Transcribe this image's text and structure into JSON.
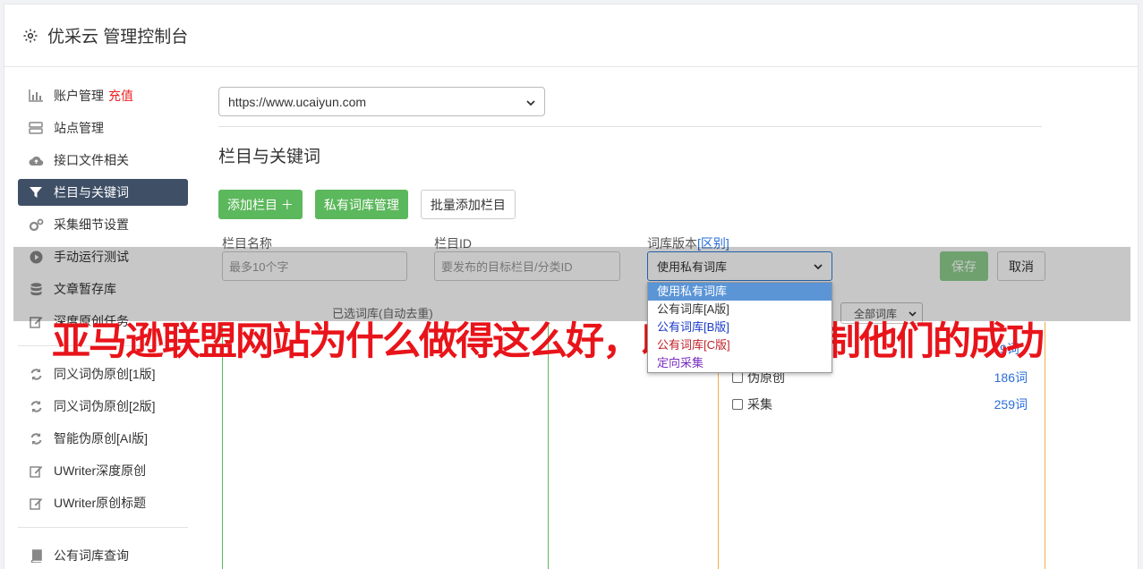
{
  "header": {
    "title": "优采云 管理控制台",
    "icon": "gear-icon"
  },
  "sidebar": {
    "items": [
      {
        "label": "账户管理",
        "badge": "充值",
        "icon": "bar-chart-icon"
      },
      {
        "label": "站点管理",
        "icon": "server-icon"
      },
      {
        "label": "接口文件相关",
        "icon": "cloud-upload-icon"
      },
      {
        "label": "栏目与关键词",
        "icon": "filter-icon",
        "active": true
      },
      {
        "label": "采集细节设置",
        "icon": "cogs-icon"
      },
      {
        "label": "手动运行测试",
        "icon": "play-circle-icon"
      },
      {
        "label": "文章暂存库",
        "icon": "database-icon"
      },
      {
        "label": "深度原创任务",
        "icon": "edit-icon"
      }
    ],
    "items2": [
      {
        "label": "同义词伪原创[1版]",
        "icon": "refresh-icon"
      },
      {
        "label": "同义词伪原创[2版]",
        "icon": "refresh-icon"
      },
      {
        "label": "智能伪原创[AI版]",
        "icon": "refresh-icon"
      },
      {
        "label": "UWriter深度原创",
        "icon": "edit-icon"
      },
      {
        "label": "UWriter原创标题",
        "icon": "edit-icon"
      }
    ],
    "items3": [
      {
        "label": "公有词库查询",
        "icon": "book-icon"
      }
    ]
  },
  "main": {
    "site_select": "https://www.ucaiyun.com",
    "section_title": "栏目与关键词",
    "buttons": {
      "add": "添加栏目 ＋",
      "private": "私有词库管理",
      "batch": "批量添加栏目"
    },
    "labels": {
      "name": "栏目名称",
      "id": "栏目ID",
      "version": "词库版本",
      "diff": "[区别]"
    },
    "placeholders": {
      "name": "最多10个字",
      "id": "要发布的目标栏目/分类ID"
    },
    "version_select": "使用私有词库",
    "save": "保存",
    "cancel": "取消",
    "selected_label": "已选词库(自动去重)",
    "all_libs": "全部词库",
    "dropdown_options": [
      "使用私有词库",
      "公有词库[A版]",
      "公有词库[B版]",
      "公有词库[C版]",
      "定向采集"
    ],
    "libs": [
      {
        "name": "伪原创",
        "count": "186词"
      },
      {
        "name": "采集",
        "count": "259词"
      }
    ],
    "partial_count": "9词"
  },
  "watermark": "亚马逊联盟网站为什么做得这么好，以及如何复制他们的成功",
  "colors": {
    "accent": "#5cb85c",
    "active_nav": "#3e4f66",
    "link": "#2a6ed8",
    "watermark": "#e8141a"
  }
}
